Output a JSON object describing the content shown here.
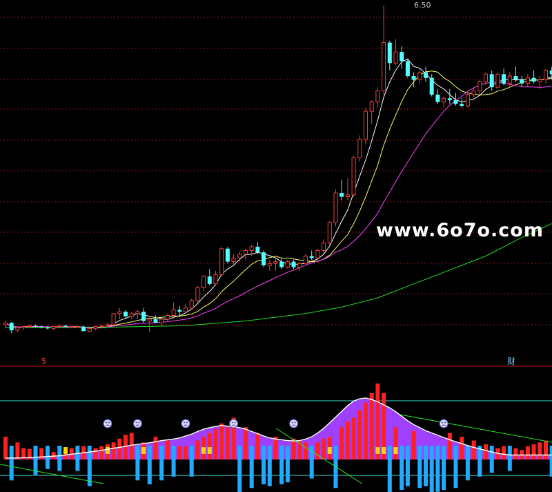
{
  "chart_data": [
    {
      "type": "candlestick",
      "high_label": "6.50",
      "colors": {
        "up": "#ff3b3b",
        "down": "#54ffff",
        "ma_fast": "#ffffff",
        "ma_mid": "#ffff66",
        "ma_slow": "#ff44ff",
        "ma_long": "#22dd22",
        "grid": "#8b1a1a"
      },
      "candles": [
        [
          3.06,
          3.1,
          3.02,
          3.08
        ],
        [
          3.08,
          3.09,
          2.97,
          3.0
        ],
        [
          3.0,
          3.04,
          2.98,
          3.03
        ],
        [
          3.03,
          3.05,
          3.0,
          3.04
        ],
        [
          3.04,
          3.06,
          3.02,
          3.05
        ],
        [
          3.05,
          3.06,
          3.03,
          3.04
        ],
        [
          3.04,
          3.05,
          3.02,
          3.03
        ],
        [
          3.03,
          3.05,
          3.01,
          3.02
        ],
        [
          3.02,
          3.05,
          3.0,
          3.04
        ],
        [
          3.04,
          3.06,
          3.02,
          3.05
        ],
        [
          3.05,
          3.06,
          3.03,
          3.04
        ],
        [
          3.04,
          3.05,
          3.02,
          3.04
        ],
        [
          3.04,
          3.05,
          3.03,
          3.04
        ],
        [
          3.04,
          3.05,
          3.02,
          2.99
        ],
        [
          2.99,
          3.03,
          2.98,
          3.02
        ],
        [
          3.02,
          3.04,
          3.0,
          3.04
        ],
        [
          3.04,
          3.06,
          3.02,
          3.05
        ],
        [
          3.05,
          3.08,
          3.03,
          3.06
        ],
        [
          3.06,
          3.12,
          3.05,
          3.18
        ],
        [
          3.18,
          3.24,
          3.12,
          3.2
        ],
        [
          3.2,
          3.22,
          3.12,
          3.15
        ],
        [
          3.15,
          3.2,
          3.12,
          3.18
        ],
        [
          3.18,
          3.22,
          3.12,
          3.2
        ],
        [
          3.2,
          3.24,
          3.08,
          3.1
        ],
        [
          3.1,
          3.14,
          2.98,
          3.12
        ],
        [
          3.12,
          3.16,
          3.08,
          3.08
        ],
        [
          3.08,
          3.12,
          3.04,
          3.12
        ],
        [
          3.12,
          3.18,
          3.1,
          3.16
        ],
        [
          3.16,
          3.3,
          3.12,
          3.22
        ],
        [
          3.22,
          3.26,
          3.14,
          3.2
        ],
        [
          3.2,
          3.28,
          3.18,
          3.24
        ],
        [
          3.24,
          3.34,
          3.22,
          3.32
        ],
        [
          3.32,
          3.48,
          3.3,
          3.46
        ],
        [
          3.46,
          3.6,
          3.42,
          3.58
        ],
        [
          3.58,
          3.66,
          3.48,
          3.5
        ],
        [
          3.5,
          3.64,
          3.48,
          3.6
        ],
        [
          3.6,
          3.9,
          3.58,
          3.88
        ],
        [
          3.88,
          3.9,
          3.72,
          3.74
        ],
        [
          3.74,
          3.82,
          3.7,
          3.78
        ],
        [
          3.78,
          3.85,
          3.74,
          3.82
        ],
        [
          3.82,
          3.88,
          3.76,
          3.86
        ],
        [
          3.86,
          3.92,
          3.8,
          3.9
        ],
        [
          3.9,
          3.95,
          3.82,
          3.84
        ],
        [
          3.84,
          3.86,
          3.68,
          3.7
        ],
        [
          3.7,
          3.76,
          3.64,
          3.72
        ],
        [
          3.72,
          3.78,
          3.64,
          3.74
        ],
        [
          3.74,
          3.78,
          3.66,
          3.68
        ],
        [
          3.68,
          3.76,
          3.66,
          3.74
        ],
        [
          3.74,
          3.76,
          3.66,
          3.68
        ],
        [
          3.68,
          3.74,
          3.64,
          3.72
        ],
        [
          3.72,
          3.82,
          3.7,
          3.8
        ],
        [
          3.8,
          3.86,
          3.76,
          3.78
        ],
        [
          3.78,
          3.88,
          3.74,
          3.86
        ],
        [
          3.86,
          3.98,
          3.82,
          3.94
        ],
        [
          3.94,
          4.18,
          3.92,
          4.16
        ],
        [
          4.16,
          4.52,
          4.12,
          4.48
        ],
        [
          4.48,
          4.62,
          4.4,
          4.44
        ],
        [
          4.44,
          4.64,
          4.4,
          4.46
        ],
        [
          4.46,
          4.88,
          4.44,
          4.86
        ],
        [
          4.86,
          5.1,
          4.82,
          5.06
        ],
        [
          5.06,
          5.4,
          5.0,
          5.36
        ],
        [
          5.36,
          5.48,
          5.22,
          5.46
        ],
        [
          5.46,
          5.62,
          5.4,
          5.58
        ],
        [
          5.58,
          6.5,
          5.54,
          6.1
        ],
        [
          6.1,
          6.12,
          5.8,
          5.88
        ],
        [
          5.88,
          6.14,
          5.86,
          6.0
        ],
        [
          6.0,
          6.06,
          5.82,
          5.9
        ],
        [
          5.9,
          5.92,
          5.72,
          5.74
        ],
        [
          5.74,
          5.78,
          5.62,
          5.7
        ],
        [
          5.7,
          5.82,
          5.66,
          5.78
        ],
        [
          5.78,
          5.84,
          5.68,
          5.72
        ],
        [
          5.72,
          5.76,
          5.52,
          5.54
        ],
        [
          5.54,
          5.6,
          5.44,
          5.46
        ],
        [
          5.46,
          5.52,
          5.4,
          5.5
        ],
        [
          5.5,
          5.6,
          5.44,
          5.48
        ],
        [
          5.48,
          5.56,
          5.42,
          5.44
        ],
        [
          5.44,
          5.5,
          5.4,
          5.42
        ],
        [
          5.42,
          5.56,
          5.4,
          5.54
        ],
        [
          5.54,
          5.62,
          5.5,
          5.58
        ],
        [
          5.58,
          5.7,
          5.54,
          5.68
        ],
        [
          5.68,
          5.78,
          5.64,
          5.76
        ],
        [
          5.76,
          5.8,
          5.58,
          5.62
        ],
        [
          5.62,
          5.78,
          5.6,
          5.76
        ],
        [
          5.76,
          5.82,
          5.64,
          5.66
        ],
        [
          5.66,
          5.78,
          5.62,
          5.74
        ],
        [
          5.74,
          5.84,
          5.68,
          5.7
        ],
        [
          5.7,
          5.74,
          5.62,
          5.66
        ],
        [
          5.66,
          5.76,
          5.62,
          5.72
        ],
        [
          5.72,
          5.8,
          5.66,
          5.68
        ],
        [
          5.68,
          5.74,
          5.6,
          5.7
        ],
        [
          5.7,
          5.82,
          5.66,
          5.8
        ],
        [
          5.8,
          5.84,
          5.7,
          5.76
        ]
      ],
      "ma_long_path": [
        [
          0,
          3.03
        ],
        [
          15,
          3.03
        ],
        [
          30,
          3.05
        ],
        [
          40,
          3.1
        ],
        [
          50,
          3.18
        ],
        [
          56,
          3.25
        ],
        [
          62,
          3.35
        ],
        [
          68,
          3.5
        ],
        [
          74,
          3.65
        ],
        [
          80,
          3.8
        ],
        [
          86,
          4.0
        ],
        [
          91,
          4.15
        ]
      ]
    },
    {
      "type": "bar",
      "colors": {
        "pos": "#ff2020",
        "neg": "#22aaff",
        "accent": "#ffd400",
        "fill": "#a040ff",
        "line": "#ffffff",
        "trend": "#22ee22"
      },
      "values": [
        0.6,
        -0.55,
        0.45,
        0.3,
        0.28,
        -0.4,
        0.3,
        -0.25,
        0.2,
        -0.3,
        0.25,
        0.3,
        -0.3,
        0.35,
        -0.7,
        0.3,
        0.35,
        0.4,
        0.45,
        0.55,
        0.65,
        0.7,
        -0.55,
        0.45,
        -0.65,
        0.6,
        -0.55,
        0.5,
        -0.45,
        0.35,
        0.35,
        -0.45,
        0.5,
        0.6,
        0.7,
        0.8,
        0.95,
        0.85,
        1.1,
        -0.9,
        0.85,
        -0.75,
        0.7,
        -0.65,
        -0.7,
        0.6,
        -0.65,
        -0.6,
        0.55,
        0.5,
        0.45,
        -0.5,
        0.45,
        0.55,
        0.6,
        -0.75,
        0.85,
        1.0,
        1.1,
        1.3,
        1.5,
        1.75,
        2.0,
        1.75,
        -0.9,
        0.85,
        -0.8,
        -0.7,
        0.75,
        -0.75,
        -0.7,
        -0.95,
        -0.85,
        -0.8,
        0.7,
        -0.75,
        0.6,
        -0.55,
        0.5,
        -0.45,
        0.4,
        -0.35,
        0.3,
        0.35,
        -0.3,
        0.3,
        0.25,
        0.35,
        0.4,
        0.45,
        0.5,
        -0.45
      ],
      "accent_bars": [
        10,
        17,
        23,
        33,
        34,
        39,
        54,
        55,
        62,
        63,
        65
      ],
      "area": [
        0.02,
        0.02,
        0.02,
        0.03,
        0.03,
        0.04,
        0.05,
        0.06,
        0.07,
        0.08,
        0.1,
        0.12,
        0.14,
        0.16,
        0.18,
        0.2,
        0.22,
        0.25,
        0.28,
        0.3,
        0.33,
        0.36,
        0.38,
        0.4,
        0.42,
        0.45,
        0.48,
        0.5,
        0.52,
        0.55,
        0.6,
        0.65,
        0.72,
        0.78,
        0.82,
        0.85,
        0.88,
        0.86,
        0.84,
        0.82,
        0.78,
        0.72,
        0.66,
        0.6,
        0.55,
        0.52,
        0.5,
        0.48,
        0.47,
        0.48,
        0.52,
        0.58,
        0.68,
        0.8,
        0.95,
        1.1,
        1.25,
        1.4,
        1.52,
        1.58,
        1.6,
        1.56,
        1.5,
        1.42,
        1.34,
        1.24,
        1.12,
        1.0,
        0.9,
        0.82,
        0.74,
        0.68,
        0.62,
        0.56,
        0.5,
        0.45,
        0.4,
        0.35,
        0.3,
        0.26,
        0.22,
        0.18,
        0.14,
        0.12,
        0.1,
        0.1,
        0.1,
        0.1,
        0.1,
        0.1,
        0.1,
        0.1
      ],
      "face_positions": [
        17,
        22,
        30,
        38,
        48,
        73
      ]
    }
  ]
}
